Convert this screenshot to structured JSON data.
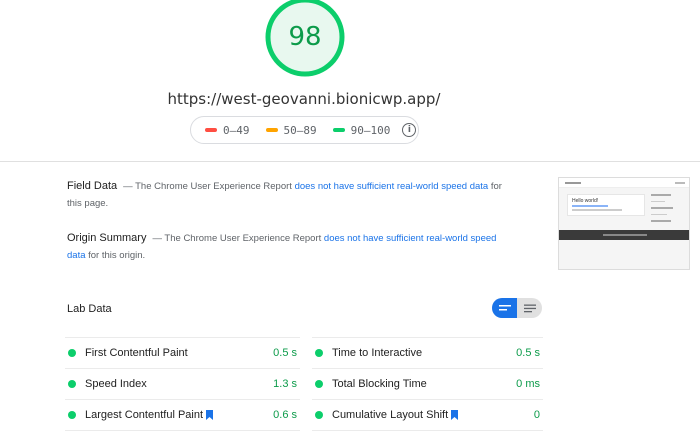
{
  "report": {
    "score": "98",
    "url": "https://west-geovanni.bionicwp.app/",
    "colors": {
      "pass": "#0cce6b",
      "pass_text": "#0c9b4a",
      "average": "#ffa400",
      "fail": "#ff4e42",
      "link": "#1a73e8"
    }
  },
  "legend": [
    {
      "label": "0–49",
      "color": "#ff4e42"
    },
    {
      "label": "50–89",
      "color": "#ffa400"
    },
    {
      "label": "90–100",
      "color": "#0cce6b"
    }
  ],
  "field": {
    "title": "Field Data",
    "pre": "— The Chrome User Experience Report ",
    "link": "does not have sufficient real-world speed data",
    "post": " for this page."
  },
  "origin": {
    "title": "Origin Summary",
    "pre": "— The Chrome User Experience Report ",
    "link": "does not have sufficient real-world speed data",
    "post": " for this origin."
  },
  "lab": {
    "title": "Lab Data",
    "metrics": [
      {
        "label": "First Contentful Paint",
        "value": "0.5 s",
        "bookmark": false
      },
      {
        "label": "Time to Interactive",
        "value": "0.5 s",
        "bookmark": false
      },
      {
        "label": "Speed Index",
        "value": "1.3 s",
        "bookmark": false
      },
      {
        "label": "Total Blocking Time",
        "value": "0 ms",
        "bookmark": false
      },
      {
        "label": "Largest Contentful Paint",
        "value": "0.6 s",
        "bookmark": true
      },
      {
        "label": "Cumulative Layout Shift",
        "value": "0",
        "bookmark": true
      }
    ]
  },
  "thumbnail": {
    "site_name": "Hello world!"
  }
}
